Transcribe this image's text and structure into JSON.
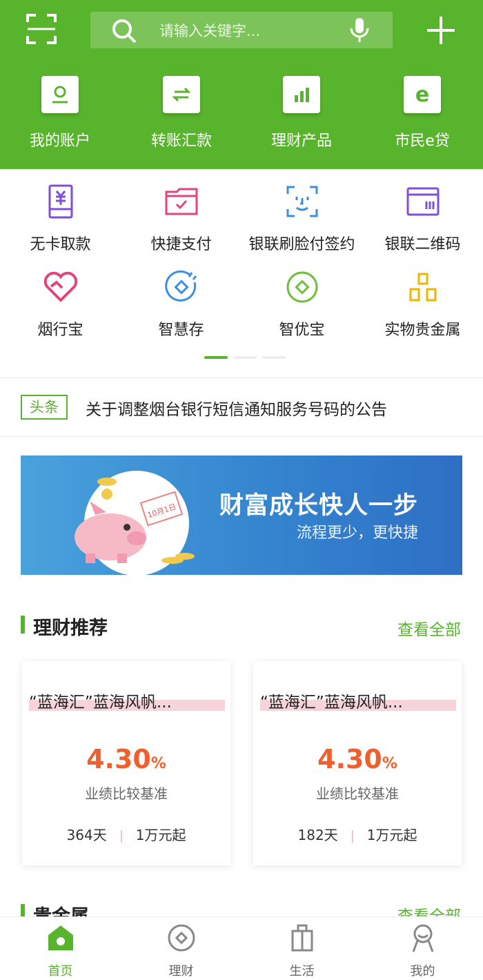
{
  "header": {
    "search_placeholder": "请输入关键字...",
    "quick": [
      {
        "label": "我的账户",
        "icon": "account-icon"
      },
      {
        "label": "转账汇款",
        "icon": "transfer-icon"
      },
      {
        "label": "理财产品",
        "icon": "chart-bar-icon"
      },
      {
        "label": "市民e贷",
        "icon": "e-loan-icon"
      }
    ]
  },
  "services": [
    {
      "label": "无卡取款",
      "icon": "yuan-phone-icon"
    },
    {
      "label": "快捷支付",
      "icon": "folder-check-icon"
    },
    {
      "label": "银联刷脸付签约",
      "icon": "face-scan-icon"
    },
    {
      "label": "银联二维码",
      "icon": "qr-window-icon"
    },
    {
      "label": "烟行宝",
      "icon": "heart-icon"
    },
    {
      "label": "智慧存",
      "icon": "deposit-circle-icon"
    },
    {
      "label": "智优宝",
      "icon": "diamond-circle-icon"
    },
    {
      "label": "实物贵金属",
      "icon": "gold-bars-icon"
    }
  ],
  "news": {
    "tag": "头条",
    "text": "关于调整烟台银行短信通知服务号码的公告"
  },
  "banner": {
    "title": "财富成长快人一步",
    "subtitle": "流程更少，更快捷",
    "note": "10月1日"
  },
  "wealth": {
    "title": "理财推荐",
    "view_all": "查看全部",
    "products": [
      {
        "name": "“蓝海汇”蓝海风帆...",
        "rate": "4.30",
        "rate_unit": "%",
        "rate_desc": "业绩比较基准",
        "term": "364天",
        "min": "1万元起"
      },
      {
        "name": "“蓝海汇”蓝海风帆...",
        "rate": "4.30",
        "rate_unit": "%",
        "rate_desc": "业绩比较基准",
        "term": "182天",
        "min": "1万元起"
      }
    ]
  },
  "section2": {
    "title": "贵金属",
    "view_all": "查看全部"
  },
  "tabbar": [
    {
      "label": "首页",
      "icon": "home-icon",
      "active": true
    },
    {
      "label": "理财",
      "icon": "wealth-coin-icon",
      "active": false
    },
    {
      "label": "生活",
      "icon": "life-bag-icon",
      "active": false
    },
    {
      "label": "我的",
      "icon": "user-icon",
      "active": false
    }
  ],
  "colors": {
    "brand": "#58b32d",
    "rate": "#f0602f",
    "banner": "#3585cf"
  }
}
